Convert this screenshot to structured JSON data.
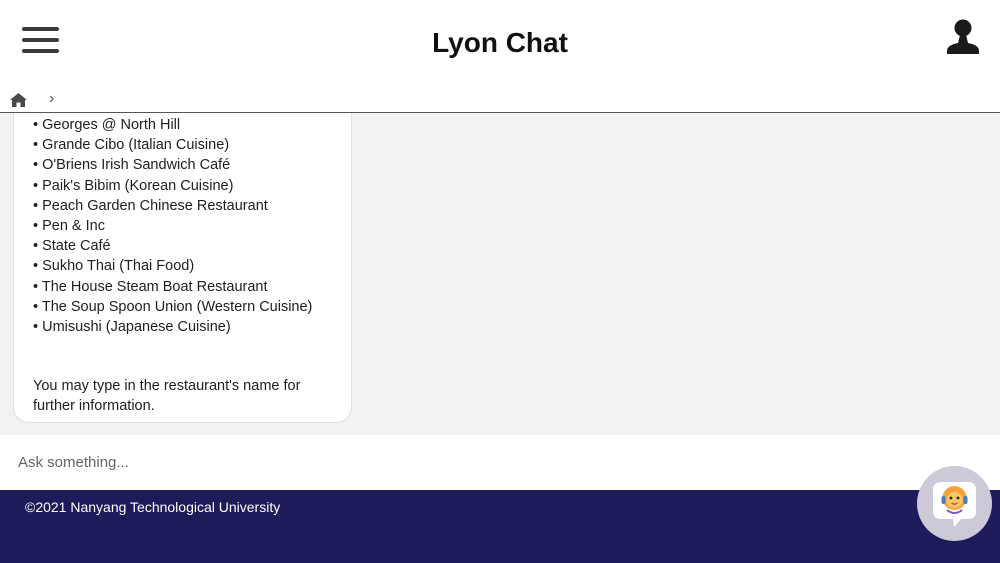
{
  "header": {
    "title": "Lyon Chat"
  },
  "chat": {
    "restaurants": [
      "• Georges @ North Hill",
      "• Grande Cibo (Italian Cuisine)",
      "• O'Briens Irish Sandwich Café",
      "• Paik's Bibim (Korean Cuisine)",
      "• Peach Garden Chinese Restaurant",
      "• Pen & Inc",
      "• State Café",
      "• Sukho Thai (Thai Food)",
      "• The House Steam Boat Restaurant",
      "• The Soup Spoon Union (Western Cuisine)",
      "• Umisushi (Japanese Cuisine)"
    ],
    "prompt": "You may type in the restaurant's name for further information."
  },
  "input": {
    "placeholder": "Ask something..."
  },
  "footer": {
    "copyright": "©2021 Nanyang Technological University"
  },
  "colors": {
    "footer_bg": "#1d1b5a",
    "chat_bg": "#f2f2f2",
    "bot_button_bg": "#cdc9d7"
  },
  "icons": {
    "menu": "hamburger-icon",
    "user": "user-icon",
    "home": "home-icon",
    "breadcrumb_separator": "chevron-right-icon",
    "bot": "lion-bot-icon"
  }
}
